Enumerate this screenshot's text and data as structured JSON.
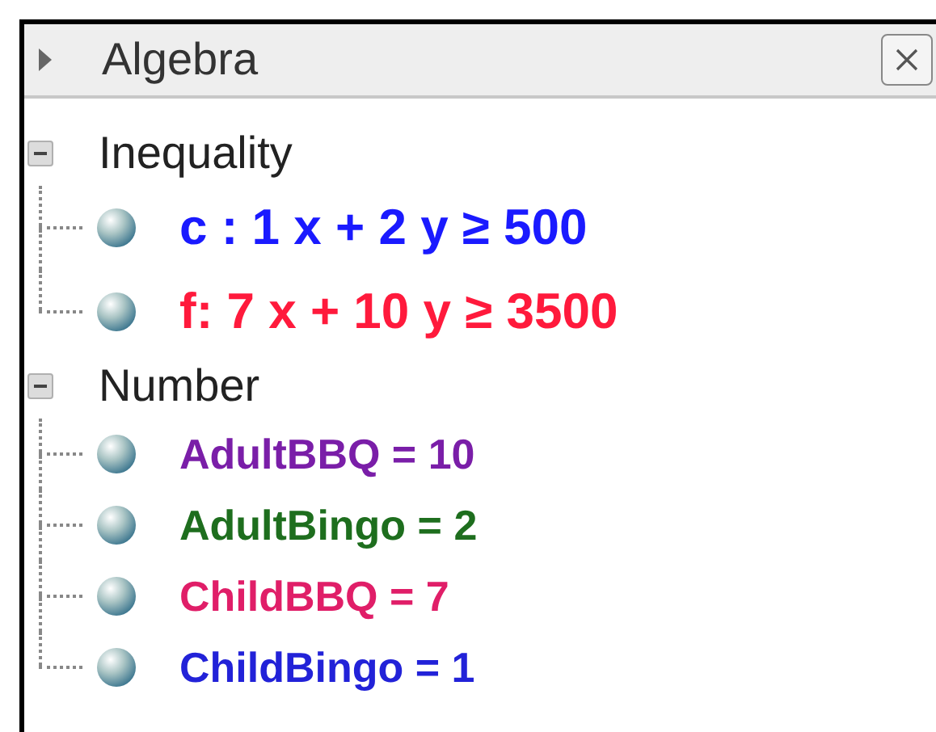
{
  "panel": {
    "title": "Algebra"
  },
  "groups": [
    {
      "label": "Inequality",
      "expanded": true,
      "children": [
        {
          "text": "c : 1 x + 2 y ≥ 500",
          "color": "#1a1aff",
          "kind": "inequality"
        },
        {
          "text": "f: 7 x + 10 y ≥ 3500",
          "color": "#ff1a3c",
          "kind": "inequality"
        }
      ]
    },
    {
      "label": "Number",
      "expanded": true,
      "children": [
        {
          "text": "AdultBBQ = 10",
          "color": "#7a1ea8",
          "kind": "number"
        },
        {
          "text": "AdultBingo = 2",
          "color": "#1e6e1e",
          "kind": "number"
        },
        {
          "text": "ChildBBQ = 7",
          "color": "#e01e68",
          "kind": "number"
        },
        {
          "text": "ChildBingo = 1",
          "color": "#2222d8",
          "kind": "number"
        }
      ]
    }
  ]
}
